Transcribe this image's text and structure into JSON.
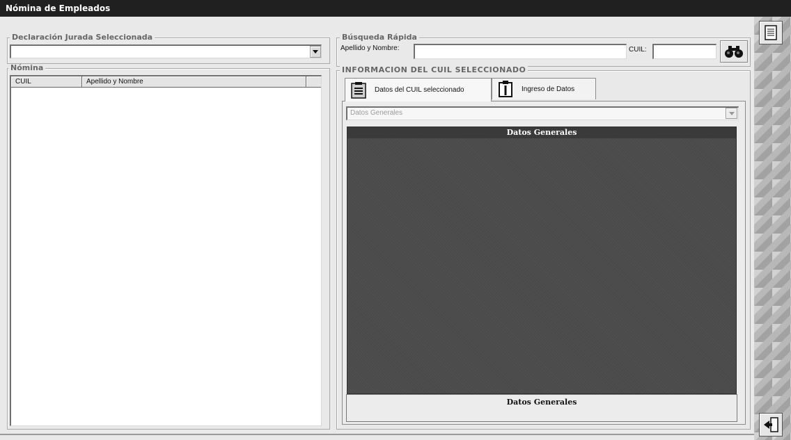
{
  "window": {
    "title": "Nómina de Empleados"
  },
  "declaracion": {
    "legend": "Declaración Jurada Seleccionada",
    "value": ""
  },
  "nomina": {
    "legend": "Nómina",
    "columns": [
      "CUIL",
      "Apellido y Nombre"
    ],
    "rows": []
  },
  "busqueda": {
    "legend": "Búsqueda Rápida",
    "name_label": "Apellido y Nombre:",
    "name_value": "",
    "cuil_label": "CUIL:",
    "cuil_value": ""
  },
  "info": {
    "legend": "INFORMACION DEL CUIL SELECCIONADO",
    "tabs": [
      {
        "label": "Datos del CUIL seleccionado",
        "icon": "clipboard-list-icon"
      },
      {
        "label": "Ingreso de Datos",
        "icon": "clipboard-pen-icon"
      }
    ],
    "section_select": "Datos Generales",
    "panel_title": "Datos Generales",
    "footer_label": "Datos Generales"
  },
  "icons": {
    "search": "binoculars-icon",
    "top_side": "list-document-icon",
    "bottom_side": "exit-door-icon"
  }
}
